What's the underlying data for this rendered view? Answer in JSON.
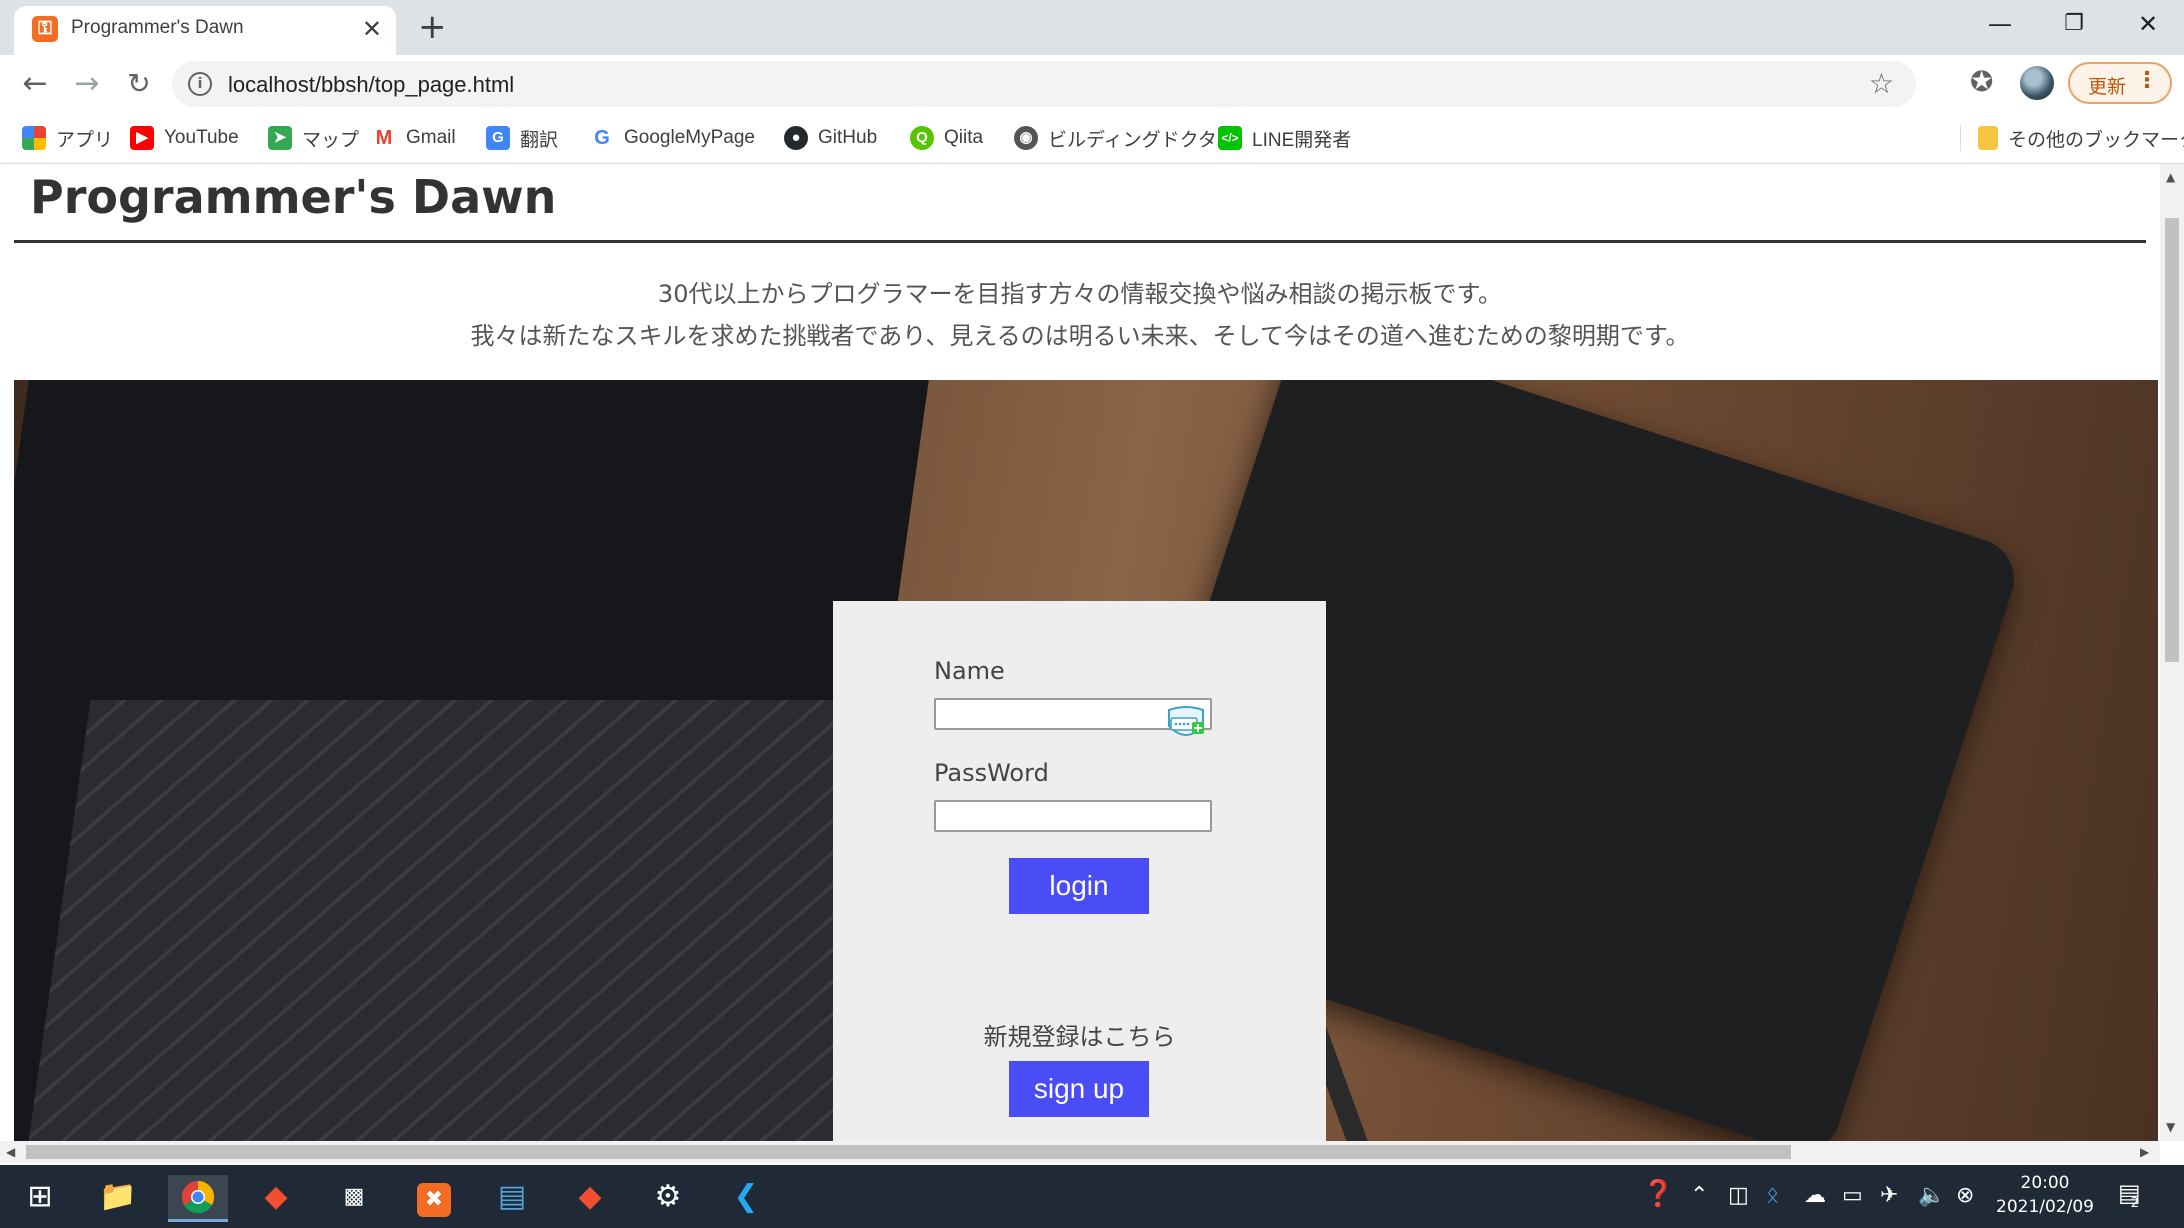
{
  "browser": {
    "tab_title": "Programmer's Dawn",
    "favicon_glyph": "⚿",
    "close_glyph": "✕",
    "new_tab_glyph": "+",
    "url": "localhost/bbsh/top_page.html",
    "update_label": "更新",
    "window_controls": {
      "minimize": "—",
      "restore": "❐",
      "close": "✕"
    }
  },
  "bookmarks": [
    {
      "label": "アプリ",
      "icon": "apps-grid-icon",
      "color": "#ea4335"
    },
    {
      "label": "YouTube",
      "icon": "youtube-icon",
      "color": "#ff0000"
    },
    {
      "label": "マップ",
      "icon": "maps-icon",
      "color": "#34a853"
    },
    {
      "label": "Gmail",
      "icon": "gmail-icon",
      "color": "#ea4335"
    },
    {
      "label": "翻訳",
      "icon": "translate-icon",
      "color": "#4285f4"
    },
    {
      "label": "GoogleMyPage",
      "icon": "google-icon",
      "color": "#4285f4"
    },
    {
      "label": "GitHub",
      "icon": "github-icon",
      "color": "#24292e"
    },
    {
      "label": "Qiita",
      "icon": "qiita-icon",
      "color": "#55c500"
    },
    {
      "label": "ビルディングドクター",
      "icon": "globe-icon",
      "color": "#555555"
    },
    {
      "label": "LINE開発者",
      "icon": "line-icon",
      "color": "#00c300"
    },
    {
      "label": "その他のブックマーク",
      "icon": "folder-icon",
      "color": "#f5c542"
    }
  ],
  "page": {
    "site_title": "Programmer's Dawn",
    "tagline_1": "30代以上からプログラマーを目指す方々の情報交換や悩み相談の掲示板です。",
    "tagline_2": "我々は新たなスキルを求めた挑戦者であり、見えるのは明るい未来、そして今はその道へ進むための黎明期です。",
    "login": {
      "name_label": "Name",
      "name_value": "",
      "password_label": "PassWord",
      "password_value": "",
      "login_button": "login",
      "signup_note": "新規登録はこちら",
      "signup_button": "sign up"
    }
  },
  "taskbar": {
    "apps": [
      "windows-start-icon",
      "file-explorer-icon",
      "chrome-icon",
      "git-icon",
      "terminal-icon",
      "xampp-icon",
      "app-icon",
      "git-icon",
      "settings-icon",
      "vscode-icon"
    ],
    "time": "20:00",
    "date": "2021/02/09",
    "notification_count": "2"
  },
  "colors": {
    "button_blue": "#4a4cf5",
    "panel_gray": "#eeeeee",
    "title_text": "#333333"
  }
}
